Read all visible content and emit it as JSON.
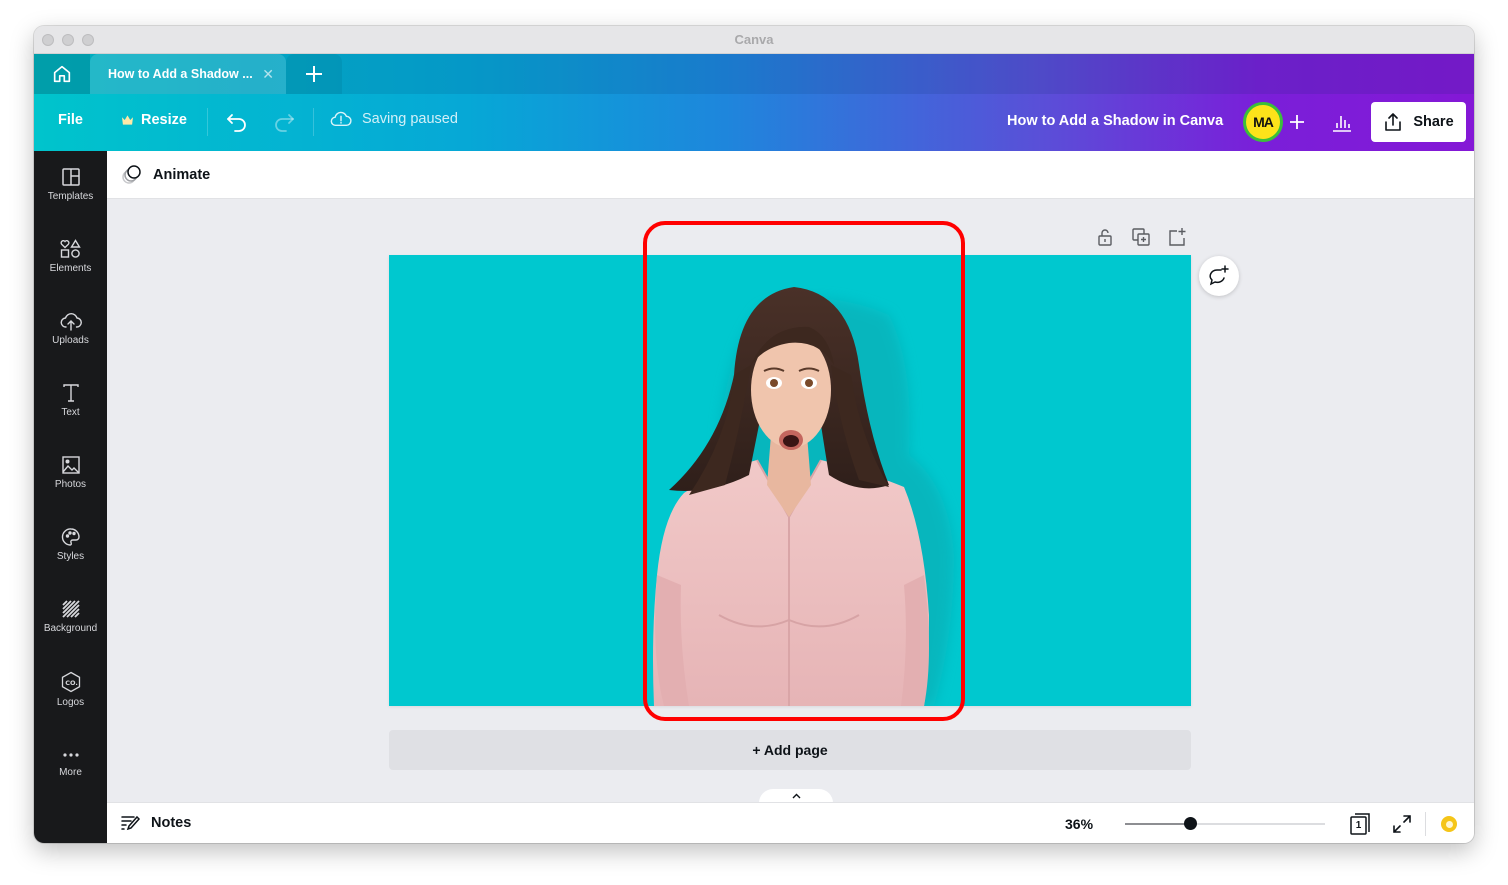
{
  "window": {
    "title": "Canva"
  },
  "tabs": {
    "home_icon": "home-icon",
    "active_tab": {
      "label": "How to Add a Shadow ...",
      "close_icon": "close-icon"
    },
    "new_tab_icon": "plus-icon"
  },
  "menubar": {
    "file_label": "File",
    "resize_label": "Resize",
    "resize_icon": "crown-icon",
    "undo_icon": "undo-icon",
    "redo_icon": "redo-icon",
    "saving_status": "Saving paused",
    "saving_icon": "cloud-alert-icon",
    "doc_title": "How to Add a Shadow in Canva",
    "avatar_initials": "MA",
    "add_collaborator_icon": "plus-icon",
    "insights_icon": "bar-chart-icon",
    "share_label": "Share",
    "share_icon": "upload-icon"
  },
  "sidebar": {
    "items": [
      {
        "label": "Templates",
        "icon": "templates-icon"
      },
      {
        "label": "Elements",
        "icon": "shapes-icon"
      },
      {
        "label": "Uploads",
        "icon": "cloud-upload-icon"
      },
      {
        "label": "Text",
        "icon": "text-icon"
      },
      {
        "label": "Photos",
        "icon": "image-icon"
      },
      {
        "label": "Styles",
        "icon": "palette-icon"
      },
      {
        "label": "Background",
        "icon": "background-pattern-icon"
      },
      {
        "label": "Logos",
        "icon": "logo-hexagon-icon"
      },
      {
        "label": "More",
        "icon": "more-dots-icon"
      }
    ]
  },
  "toolbar": {
    "animate_label": "Animate",
    "animate_icon": "animate-circles-icon"
  },
  "canvas": {
    "page_tools": [
      "lock-icon",
      "duplicate-page-icon",
      "add-page-icon"
    ],
    "comment_icon": "add-comment-icon",
    "background_color": "#00c8cf",
    "highlight_color": "#ff0000",
    "image_subject": "Surprised woman in pink shirt with drop shadow",
    "add_page_label": "+ Add page",
    "collapse_icon": "chevron-up-icon"
  },
  "footer": {
    "notes_label": "Notes",
    "notes_icon": "notes-pencil-icon",
    "zoom_level": "36%",
    "zoom_fraction": 0.36,
    "page_count": "1",
    "fullscreen_icon": "expand-icon",
    "help_icon": "help-icon"
  }
}
